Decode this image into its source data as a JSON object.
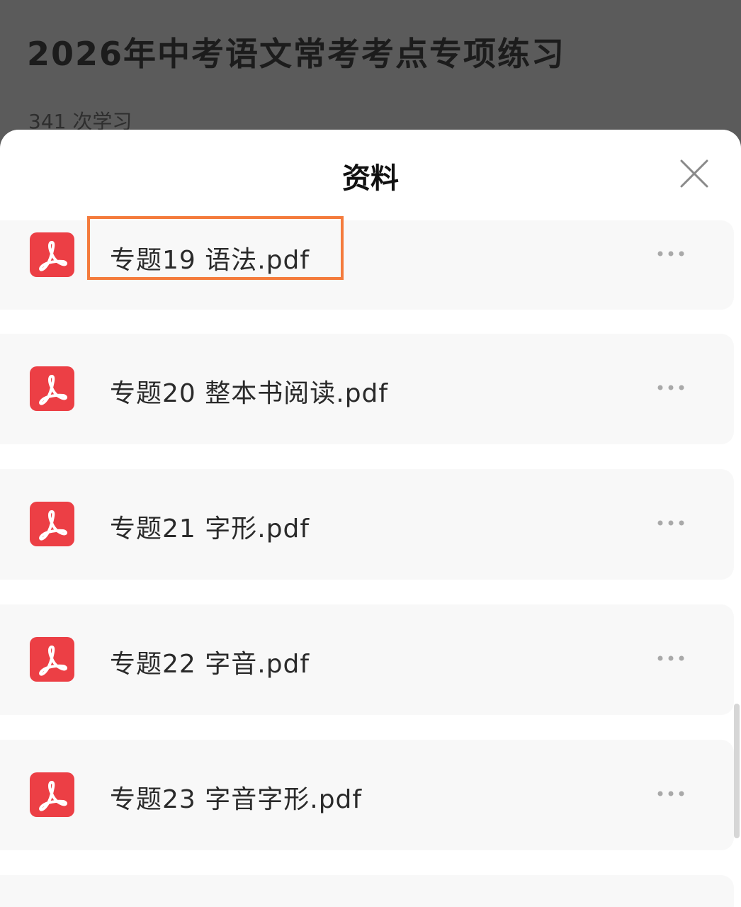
{
  "background": {
    "course_title": "2026年中考语文常考考点专项练习",
    "learner_count": "341 次学习"
  },
  "sheet": {
    "title": "资料",
    "close_icon": "close-icon",
    "items": [
      {
        "name": "专题19 语法.pdf",
        "icon": "pdf-icon",
        "highlighted": true
      },
      {
        "name": "专题20 整本书阅读.pdf",
        "icon": "pdf-icon",
        "highlighted": false
      },
      {
        "name": "专题21 字形.pdf",
        "icon": "pdf-icon",
        "highlighted": false
      },
      {
        "name": "专题22 字音.pdf",
        "icon": "pdf-icon",
        "highlighted": false
      },
      {
        "name": "专题23 字音字形.pdf",
        "icon": "pdf-icon",
        "highlighted": false
      }
    ]
  },
  "colors": {
    "pdf_red": "#ec3f45",
    "highlight_orange": "#f47b3c",
    "backdrop": "#5b5b5b"
  }
}
